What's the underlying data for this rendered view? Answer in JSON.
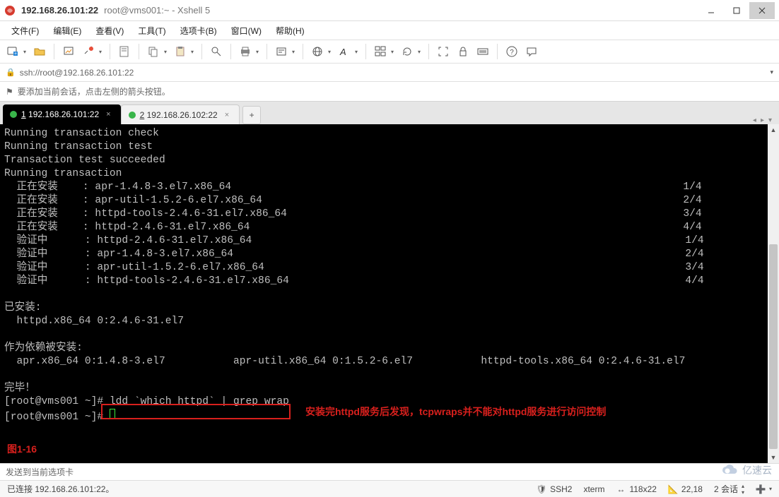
{
  "title": {
    "main": "192.168.26.101:22",
    "sub": "root@vms001:~ - Xshell 5"
  },
  "menu": {
    "file": "文件(F)",
    "edit": "编辑(E)",
    "view": "查看(V)",
    "tools": "工具(T)",
    "tabs": "选项卡(B)",
    "window": "窗口(W)",
    "help": "帮助(H)"
  },
  "addressbar": {
    "url": "ssh://root@192.168.26.101:22"
  },
  "hint": {
    "text": "要添加当前会话，点击左侧的箭头按钮。"
  },
  "tabs": [
    {
      "num": "1",
      "label": "192.168.26.101:22",
      "active": true
    },
    {
      "num": "2",
      "label": "192.168.26.102:22",
      "active": false
    }
  ],
  "terminal": {
    "lines": [
      "Running transaction check",
      "Running transaction test",
      "Transaction test succeeded",
      "Running transaction",
      "  正在安装    : apr-1.4.8-3.el7.x86_64                                                                         1/4",
      "  正在安装    : apr-util-1.5.2-6.el7.x86_64                                                                    2/4",
      "  正在安装    : httpd-tools-2.4.6-31.el7.x86_64                                                                3/4",
      "  正在安装    : httpd-2.4.6-31.el7.x86_64                                                                      4/4",
      "  验证中      : httpd-2.4.6-31.el7.x86_64                                                                      1/4",
      "  验证中      : apr-1.4.8-3.el7.x86_64                                                                         2/4",
      "  验证中      : apr-util-1.5.2-6.el7.x86_64                                                                    3/4",
      "  验证中      : httpd-tools-2.4.6-31.el7.x86_64                                                                4/4",
      "",
      "已安装:",
      "  httpd.x86_64 0:2.4.6-31.el7",
      "",
      "作为依赖被安装:",
      "  apr.x86_64 0:1.4.8-3.el7           apr-util.x86_64 0:1.5.2-6.el7           httpd-tools.x86_64 0:2.4.6-31.el7",
      "",
      "完毕！",
      "[root@vms001 ~]# ldd `which httpd` | grep wrap",
      "[root@vms001 ~]# "
    ],
    "highlighted_command": "ldd `which httpd` | grep wrap",
    "annotation_text": "安装完httpd服务后发现，tcpwraps并不能对httpd服务进行访问控制"
  },
  "figure_label": "图1-16",
  "footnote": "发送到当前选项卡",
  "status": {
    "connected": "已连接 192.168.26.101:22。",
    "proto": "SSH2",
    "term": "xterm",
    "size": "118x22",
    "pos": "22,18",
    "sessions": "2 会话"
  },
  "watermark": "亿速云"
}
